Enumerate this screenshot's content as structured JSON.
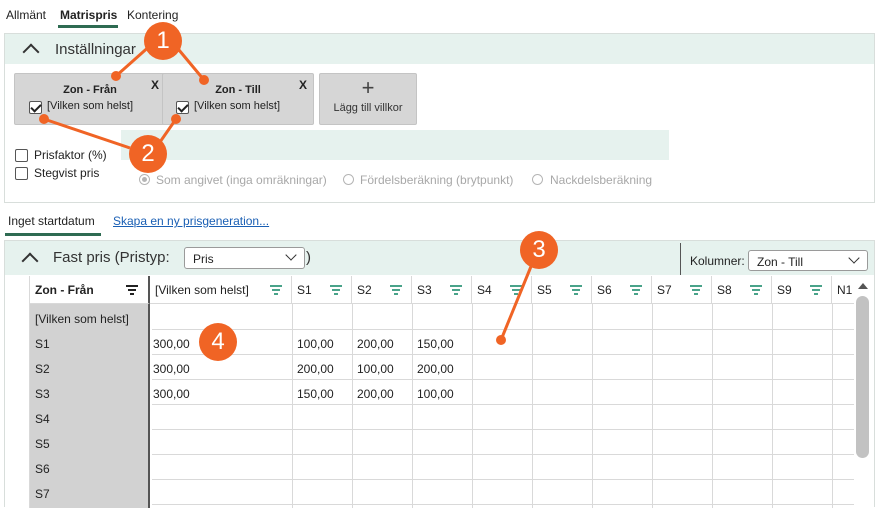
{
  "top_tabs": [
    {
      "label": "Allmänt"
    },
    {
      "label": "Matrispris"
    },
    {
      "label": "Kontering"
    }
  ],
  "settings": {
    "title": "Inställningar",
    "conditions": [
      {
        "title": "Zon - Från",
        "value": "[Vilken som helst]",
        "close": "X",
        "checked": true
      },
      {
        "title": "Zon - Till",
        "value": "[Vilken som helst]",
        "close": "X",
        "checked": true
      }
    ],
    "add_condition": {
      "icon": "+",
      "label": "Lägg till villkor"
    },
    "options": [
      {
        "label": "Prisfaktor (%)",
        "checked": false
      },
      {
        "label": "Stegvist pris",
        "checked": false
      }
    ],
    "radios": [
      {
        "label": "Som angivet (inga omräkningar)",
        "selected": true
      },
      {
        "label": "Fördelsberäkning (brytpunkt)",
        "selected": false
      },
      {
        "label": "Nackdelsberäkning",
        "selected": false
      }
    ]
  },
  "date_tabs": {
    "active": "Inget startdatum",
    "link": "Skapa en ny prisgeneration..."
  },
  "grid": {
    "title_prefix": "Fast pris (Pristyp:",
    "title_suffix": ")",
    "pristyp_value": "Pris",
    "columns_label": "Kolumner:",
    "columns_value": "Zon - Till",
    "row_header_label": "Zon - Från",
    "columns": [
      "[Vilken som helst]",
      "S1",
      "S2",
      "S3",
      "S4",
      "S5",
      "S6",
      "S7",
      "S8",
      "S9",
      "N1"
    ],
    "rows": [
      {
        "label": "[Vilken som helst]",
        "cells": [
          "",
          "",
          "",
          ""
        ]
      },
      {
        "label": "S1",
        "cells": [
          "300,00",
          "100,00",
          "200,00",
          "150,00"
        ]
      },
      {
        "label": "S2",
        "cells": [
          "300,00",
          "200,00",
          "100,00",
          "200,00"
        ]
      },
      {
        "label": "S3",
        "cells": [
          "300,00",
          "150,00",
          "200,00",
          "100,00"
        ]
      },
      {
        "label": "S4",
        "cells": [
          "",
          "",
          "",
          ""
        ]
      },
      {
        "label": "S5",
        "cells": [
          "",
          "",
          "",
          ""
        ]
      },
      {
        "label": "S6",
        "cells": [
          "",
          "",
          "",
          ""
        ]
      },
      {
        "label": "S7",
        "cells": [
          "",
          "",
          "",
          ""
        ]
      }
    ]
  },
  "callouts": [
    "1",
    "2",
    "3",
    "4"
  ],
  "colors": {
    "accent": "#2e6b52",
    "header_bg": "#e6f2ee",
    "callout": "#f06425",
    "filter": "#4aa38a"
  },
  "icons": {
    "collapse": "chevron-up-icon",
    "filter": "filter-icon",
    "dropdown": "chevron-down-icon",
    "add": "plus-icon"
  }
}
